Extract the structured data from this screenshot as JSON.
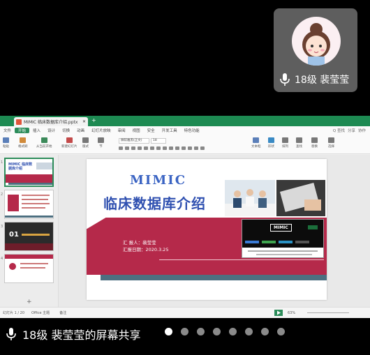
{
  "participant": {
    "name": "18级 裴莹莹"
  },
  "share": {
    "label": "18级 裴莹莹的屏幕共享"
  },
  "app": {
    "doc_tab": "MIMIC 临床数据库介绍.pptx",
    "menus": [
      "文件",
      "开始",
      "插入",
      "设计",
      "切换",
      "动画",
      "幻灯片放映",
      "审阅",
      "视图",
      "安全",
      "开发工具",
      "特色功能"
    ],
    "active_menu": "开始",
    "menu_right": [
      "Q 查找",
      "分享",
      "协作"
    ],
    "ribbon": [
      "粘贴",
      "格式刷",
      "从当前开始",
      "新建幻灯片",
      "版式",
      "节",
      "文本框",
      "形状",
      "排列",
      "查找",
      "替换",
      "选择"
    ],
    "font": "微软雅黑(正文)",
    "font_size": "18",
    "status_left": "幻灯片 1 / 20",
    "status_theme": "Office 主题",
    "status_notes": "备注",
    "zoom": "63%"
  },
  "slide": {
    "title": "MIMIC",
    "subtitle": "临床数据库介绍",
    "reporter": "汇 报人：裴莹莹",
    "date": "汇报日期：2020.3.25",
    "mimic_logo": "MIMIC"
  },
  "thumbs": [
    {
      "num": "1",
      "text": "MIMIC 临床数据库介绍"
    },
    {
      "num": "2",
      "text": ""
    },
    {
      "num": "3",
      "text": "01"
    },
    {
      "num": "4",
      "text": ""
    }
  ],
  "pager": {
    "count": 8,
    "active_index": 0
  },
  "colors": {
    "accent_green": "#2c8c5a",
    "slide_red": "#b5294a",
    "title_blue": "#3b64c3"
  }
}
